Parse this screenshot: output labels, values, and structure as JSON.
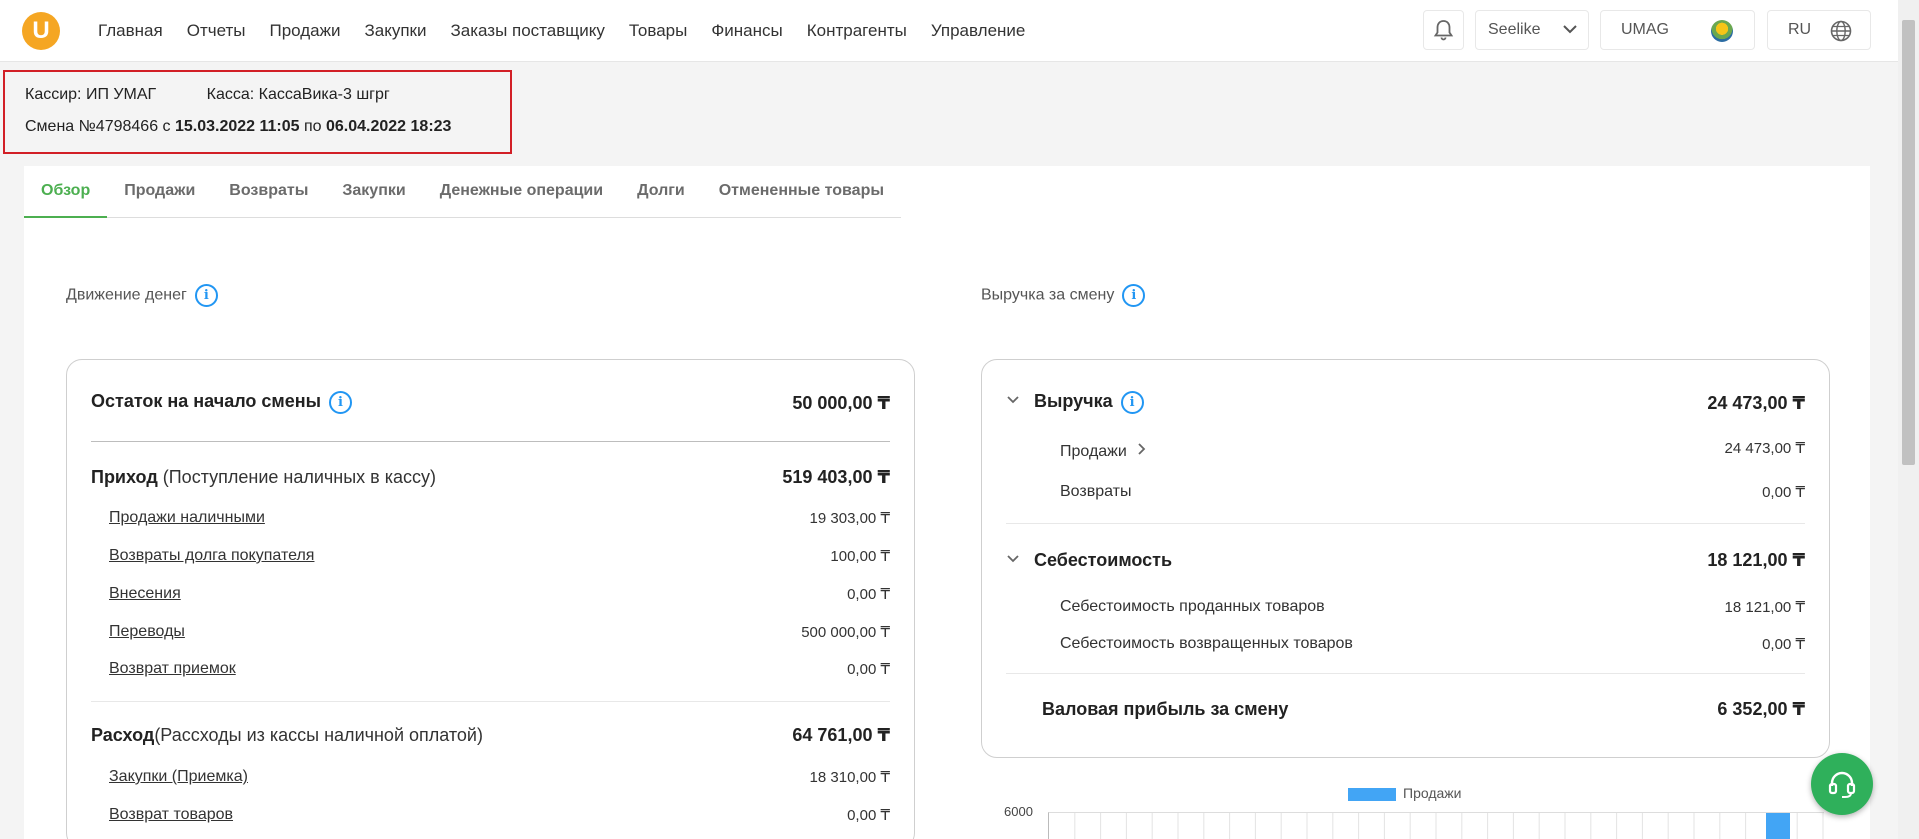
{
  "app": {
    "logo_letter": "U"
  },
  "nav": [
    "Главная",
    "Отчеты",
    "Продажи",
    "Закупки",
    "Заказы поставщику",
    "Товары",
    "Финансы",
    "Контрагенты",
    "Управление"
  ],
  "header": {
    "store": "Seelike",
    "user": "UMAG",
    "lang": "RU"
  },
  "shift": {
    "cashier": "Кассир: ИП УМАГ",
    "register": "Касса: КассаВика-3 шгрг",
    "prefix": "Смена №4798466 с ",
    "from": "15.03.2022 11:05",
    "mid": " по ",
    "to": "06.04.2022 18:23"
  },
  "tabs": [
    "Обзор",
    "Продажи",
    "Возвраты",
    "Закупки",
    "Денежные операции",
    "Долги",
    "Отмененные товары"
  ],
  "money": {
    "title": "Движение денег",
    "opening_label": "Остаток на начало смены",
    "opening_value": "50 000,00 ₸",
    "income_label": "Приход",
    "income_note": " (Поступление наличных в кассу)",
    "income_value": "519 403,00 ₸",
    "income_items": [
      {
        "label": "Продажи наличными",
        "value": "19 303,00 ₸"
      },
      {
        "label": "Возвраты долга покупателя",
        "value": "100,00 ₸"
      },
      {
        "label": "Внесения",
        "value": "0,00 ₸"
      },
      {
        "label": "Переводы",
        "value": "500 000,00 ₸"
      },
      {
        "label": "Возврат приемок",
        "value": "0,00 ₸"
      }
    ],
    "expense_label": "Расход",
    "expense_note": "(Рассходы из кассы наличной оплатой)",
    "expense_value": "64 761,00 ₸",
    "expense_items": [
      {
        "label": "Закупки (Приемка)",
        "value": "18 310,00 ₸"
      },
      {
        "label": "Возврат товаров",
        "value": "0,00 ₸"
      }
    ]
  },
  "revenue": {
    "title": "Выручка за смену",
    "revenue_label": "Выручка",
    "revenue_value": "24 473,00 ₸",
    "sales_label": "Продажи",
    "sales_value": "24 473,00 ₸",
    "returns_label": "Возвраты",
    "returns_value": "0,00 ₸",
    "cost_label": "Себестоимость",
    "cost_value": "18 121,00 ₸",
    "cost_sold_label": "Себестоимость проданных товаров",
    "cost_sold_value": "18 121,00 ₸",
    "cost_returned_label": "Себестоимость возвращенных товаров",
    "cost_returned_value": "0,00 ₸",
    "gross_label": "Валовая прибыль за смену",
    "gross_value": "6 352,00 ₸"
  },
  "chart_data": {
    "type": "bar",
    "legend": [
      "Продажи"
    ],
    "y_ticks": [
      "6000"
    ],
    "colors": {
      "bar": "#42a5f5"
    }
  },
  "colors": {
    "accent": "#4caf50",
    "info": "#2196f3",
    "highlight_border": "#d21f26",
    "logo": "#f5a623"
  }
}
